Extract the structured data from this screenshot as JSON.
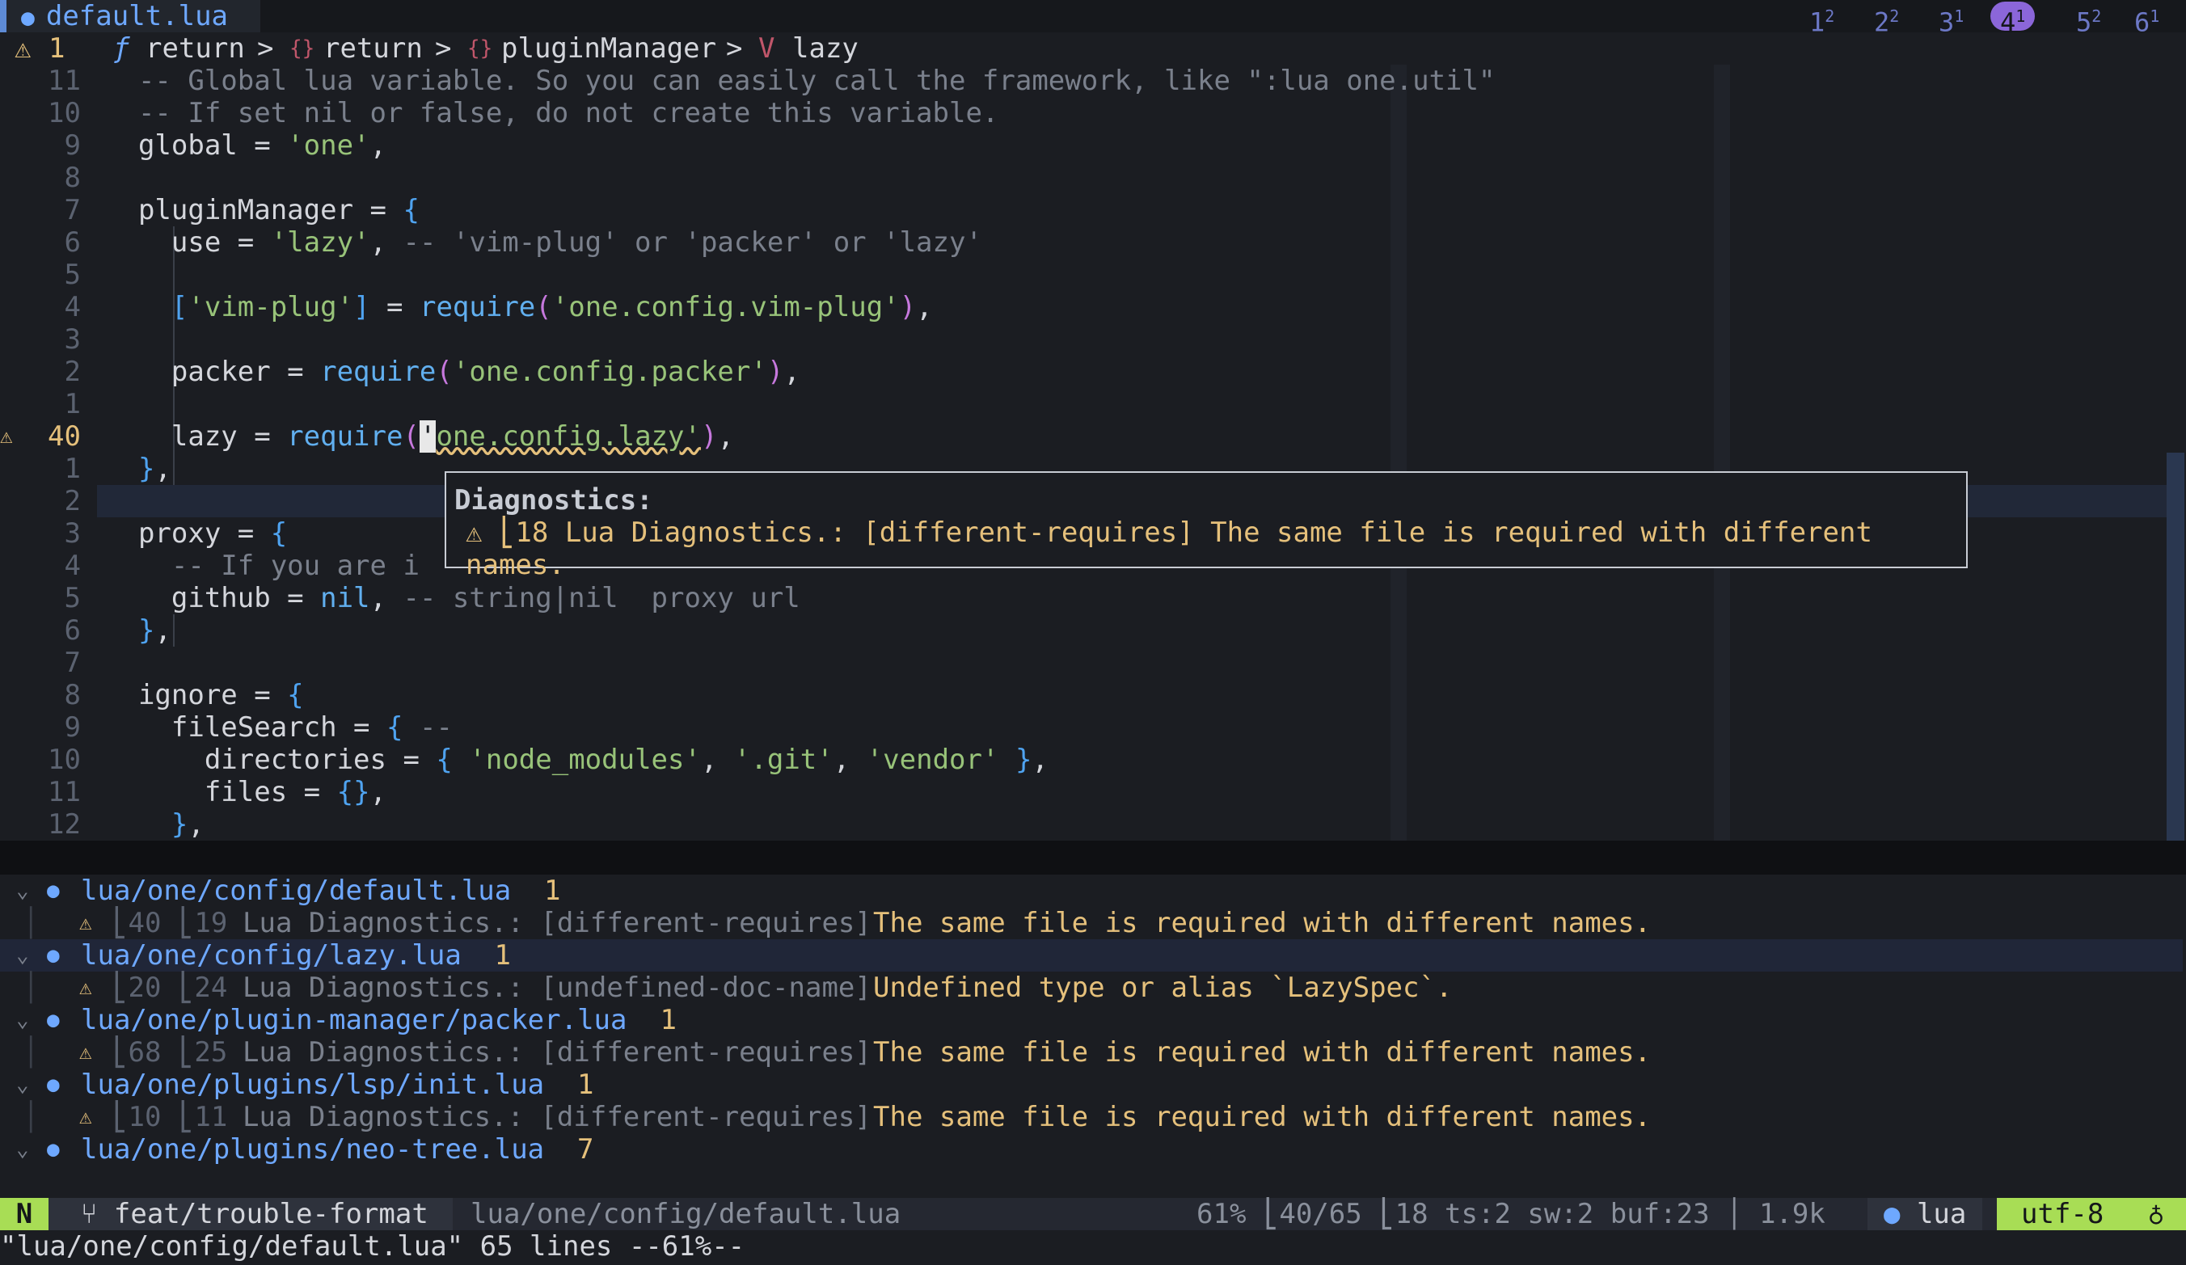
{
  "tabline": {
    "active_tab": "default.lua",
    "workspaces": [
      {
        "label": "1",
        "count": "2"
      },
      {
        "label": "2",
        "count": "2"
      },
      {
        "label": "3",
        "count": "1"
      },
      {
        "label": "4",
        "count": "1",
        "active": true
      },
      {
        "label": "5",
        "count": "2"
      },
      {
        "label": "6",
        "count": "1"
      }
    ]
  },
  "winbar": {
    "warn_count": "1",
    "crumbs": [
      "return",
      "return",
      "pluginManager",
      "lazy"
    ],
    "sep": ">"
  },
  "editor": {
    "lines": [
      {
        "ln": "11",
        "text": "  -- Global lua variable. So you can easily call the framework, like \":lua one.util\""
      },
      {
        "ln": "10",
        "text": "  -- If set nil or false, do not create this variable."
      },
      {
        "ln": "9",
        "text": "  global = 'one',"
      },
      {
        "ln": "8",
        "text": ""
      },
      {
        "ln": "7",
        "text": "  pluginManager = {"
      },
      {
        "ln": "6",
        "text": "    use = 'lazy', -- 'vim-plug' or 'packer' or 'lazy'"
      },
      {
        "ln": "5",
        "text": ""
      },
      {
        "ln": "4",
        "text": "    ['vim-plug'] = require('one.config.vim-plug'),"
      },
      {
        "ln": "3",
        "text": ""
      },
      {
        "ln": "2",
        "text": "    packer = require('one.config.packer'),"
      },
      {
        "ln": "1",
        "text": ""
      },
      {
        "ln": "40",
        "text": "    lazy = require('one.config.lazy'),",
        "current": true
      },
      {
        "ln": "1",
        "text": "  },"
      },
      {
        "ln": "2",
        "text": ""
      },
      {
        "ln": "3",
        "text": "  proxy = {"
      },
      {
        "ln": "4",
        "text": "    -- If you are i"
      },
      {
        "ln": "5",
        "text": "    github = nil, -- string|nil  proxy url"
      },
      {
        "ln": "6",
        "text": "  },"
      },
      {
        "ln": "7",
        "text": ""
      },
      {
        "ln": "8",
        "text": "  ignore = {"
      },
      {
        "ln": "9",
        "text": "    fileSearch = { --"
      },
      {
        "ln": "10",
        "text": "      directories = { 'node_modules', '.git', 'vendor' },"
      },
      {
        "ln": "11",
        "text": "      files = {},"
      },
      {
        "ln": "12",
        "text": "    },"
      }
    ]
  },
  "float": {
    "title": "Diagnostics:",
    "message": "⚠ ⎣18 Lua Diagnostics.: [different-requires] The same file is required with different names."
  },
  "trouble": {
    "groups": [
      {
        "file": "lua/one/config/default.lua",
        "count": "1",
        "items": [
          {
            "pos": "⎣40 ⎣19",
            "src": "Lua Diagnostics.: [different-requires]",
            "msg": "The same file is required with different names."
          }
        ]
      },
      {
        "file": "lua/one/config/lazy.lua",
        "count": "1",
        "items": [
          {
            "pos": "⎣20 ⎣24",
            "src": "Lua Diagnostics.: [undefined-doc-name]",
            "msg": "Undefined type or alias `LazySpec`."
          }
        ]
      },
      {
        "file": "lua/one/plugin-manager/packer.lua",
        "count": "1",
        "items": [
          {
            "pos": "⎣68 ⎣25",
            "src": "Lua Diagnostics.: [different-requires]",
            "msg": "The same file is required with different names."
          }
        ]
      },
      {
        "file": "lua/one/plugins/lsp/init.lua",
        "count": "1",
        "items": [
          {
            "pos": "⎣10 ⎣11",
            "src": "Lua Diagnostics.: [different-requires]",
            "msg": "The same file is required with different names."
          }
        ]
      },
      {
        "file": "lua/one/plugins/neo-tree.lua",
        "count": "7",
        "items": []
      }
    ]
  },
  "status": {
    "mode": "N",
    "branch": "feat/trouble-format",
    "path": "lua/one/config/default.lua",
    "right": "61% ⎣40/65 ⎣18 ts:2 sw:2 buf:23 │ 1.9k",
    "filetype": "lua",
    "encoding": "utf-8",
    "end_glyph": "♁"
  },
  "cmdline": "\"lua/one/config/default.lua\" 65 lines --61%--",
  "colors": {
    "accent": "#a8dd55",
    "warn": "#e5c07b",
    "string": "#98c379",
    "func": "#61afef",
    "keyword": "#c678dd"
  }
}
